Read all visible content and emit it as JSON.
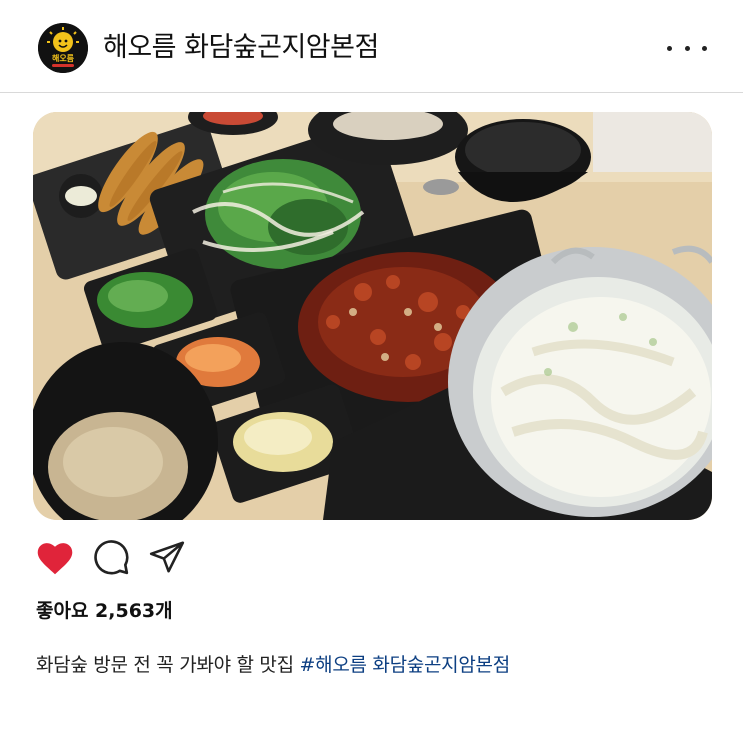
{
  "post": {
    "account_name": "해오름 화담숲곤지암본점",
    "avatar_logo_text": "해오름",
    "likes_text": "좋아요 2,563개",
    "caption": {
      "text": "화담숲 방문 전 꼭 가봐야 할 맛집",
      "hashtag": "#해오름 화담숲곤지암본점"
    },
    "photo_alt": "Korean spicy octopus, kalguksu noodle pot, fried shrimp, salad, side dishes and rice"
  },
  "icons": {
    "more": "more-dots-icon",
    "like": "heart-icon",
    "comment": "comment-icon",
    "share": "send-icon"
  },
  "colors": {
    "like_active": "#e0243a",
    "hashtag": "#0d3f82",
    "divider": "#d9d9d9"
  }
}
